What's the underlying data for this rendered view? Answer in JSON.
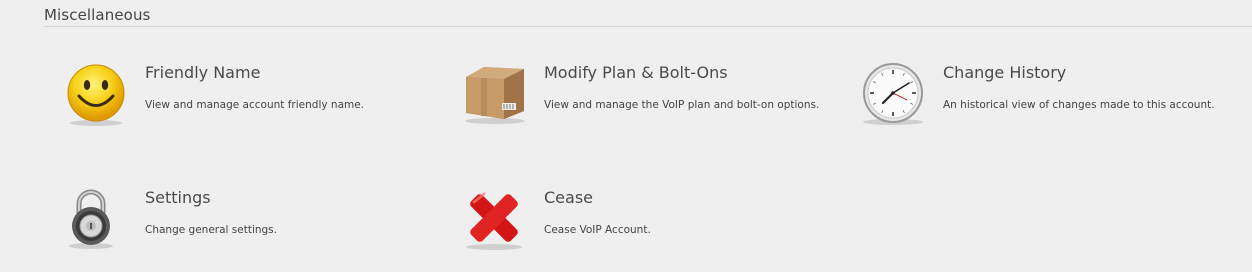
{
  "section": {
    "title": "Miscellaneous"
  },
  "items": [
    {
      "title": "Friendly Name",
      "description": "View and manage account friendly name.",
      "icon": "smiley-face-icon"
    },
    {
      "title": "Modify Plan & Bolt-Ons",
      "description": "View and manage the VoIP plan and bolt-on options.",
      "icon": "cardboard-box-icon"
    },
    {
      "title": "Change History",
      "description": "An historical view of changes made to this account.",
      "icon": "clock-icon"
    },
    {
      "title": "Settings",
      "description": "Change general settings.",
      "icon": "padlock-icon"
    },
    {
      "title": "Cease",
      "description": "Cease VoIP Account.",
      "icon": "red-x-icon"
    }
  ]
}
